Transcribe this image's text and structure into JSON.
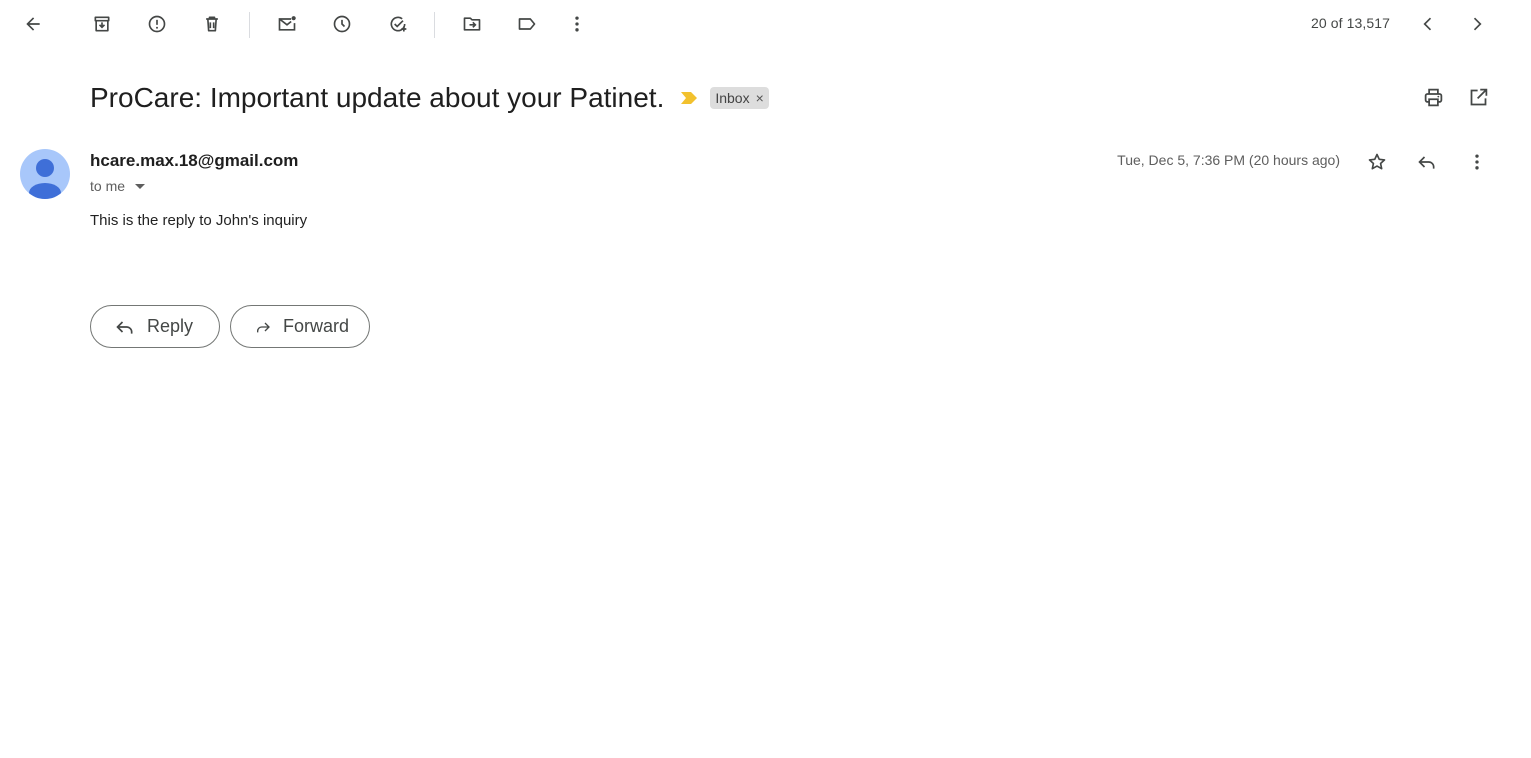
{
  "toolbar": {
    "buttons": [
      "back-icon",
      "archive-icon",
      "report-spam-icon",
      "delete-icon",
      "mark-unread-icon",
      "snooze-icon",
      "add-task-icon",
      "move-to-icon",
      "label-icon",
      "more-vert-icon"
    ],
    "pager_text": "20 of 13,517"
  },
  "subject": {
    "text": "ProCare: Important update about your Patinet.",
    "importance_color": "#f2c12e",
    "label": "Inbox",
    "label_remove": "×"
  },
  "message": {
    "sender": "hcare.max.18@gmail.com",
    "recipient": "to me",
    "date": "Tue, Dec 5, 7:36 PM (20 hours ago)",
    "body": "This is the reply to John's inquiry"
  },
  "actions": {
    "reply_label": "Reply",
    "forward_label": "Forward"
  },
  "colors": {
    "icon": "#444746",
    "avatar_bg": "#a8c7fa",
    "avatar_fg": "#3f6fd8"
  }
}
